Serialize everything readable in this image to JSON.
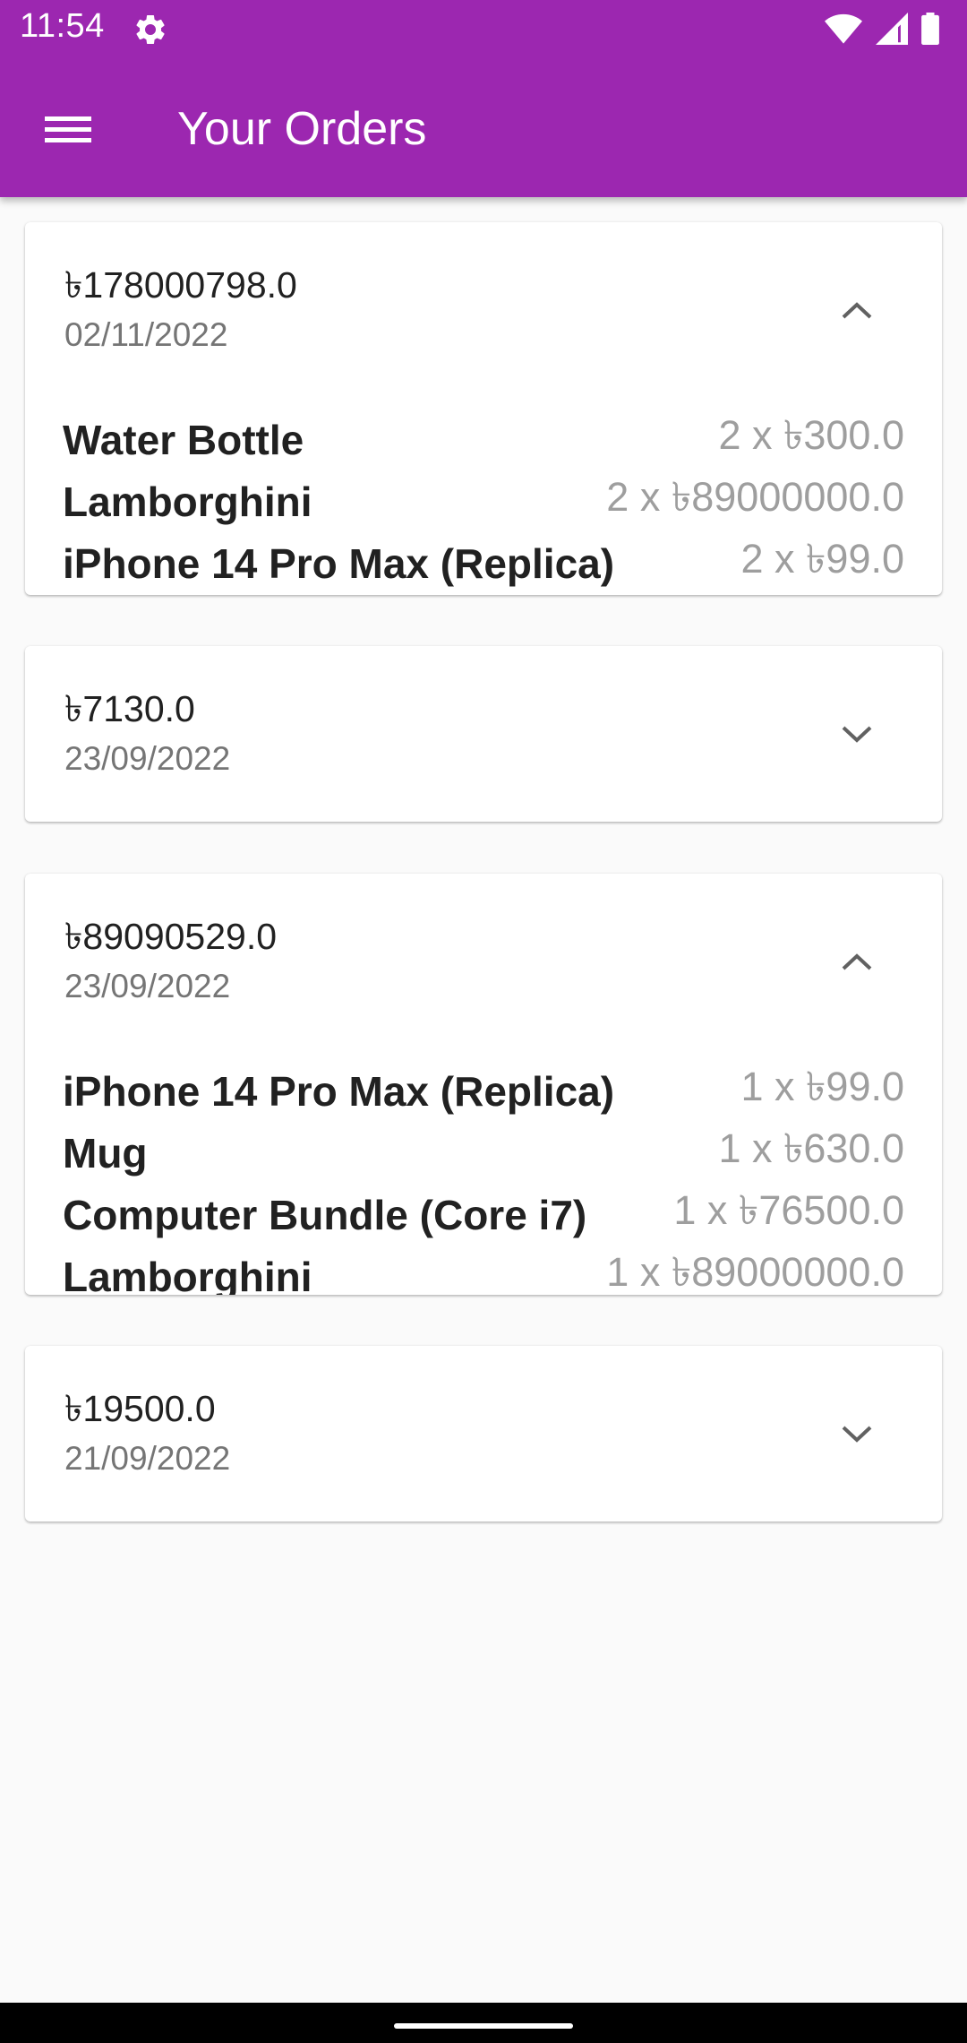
{
  "status_bar": {
    "time": "11:54",
    "icons": [
      "settings-icon",
      "wifi-icon",
      "signal-icon",
      "battery-icon"
    ]
  },
  "app_bar": {
    "title": "Your Orders",
    "menu_icon": "hamburger-menu-icon",
    "color": "#9c27b0"
  },
  "orders": [
    {
      "total": "৳178000798.0",
      "date": "02/11/2022",
      "expanded": true,
      "toggle_icon": "chevron-up-icon",
      "items": [
        {
          "name": "Water Bottle",
          "qty": "2 x ৳300.0"
        },
        {
          "name": "Lamborghini",
          "qty": "2 x ৳89000000.0"
        },
        {
          "name": "iPhone 14 Pro Max (Replica)",
          "qty": "2 x ৳99.0"
        }
      ]
    },
    {
      "total": "৳7130.0",
      "date": "23/09/2022",
      "expanded": false,
      "toggle_icon": "chevron-down-icon",
      "items": []
    },
    {
      "total": "৳89090529.0",
      "date": "23/09/2022",
      "expanded": true,
      "toggle_icon": "chevron-up-icon",
      "items": [
        {
          "name": "iPhone 14 Pro Max (Replica)",
          "qty": "1 x ৳99.0"
        },
        {
          "name": "Mug",
          "qty": "1 x ৳630.0"
        },
        {
          "name": "Computer Bundle (Core i7)",
          "qty": "1 x ৳76500.0"
        },
        {
          "name": "Lamborghini",
          "qty": "1 x ৳89000000.0"
        }
      ]
    },
    {
      "total": "৳19500.0",
      "date": "21/09/2022",
      "expanded": false,
      "toggle_icon": "chevron-down-icon",
      "items": []
    }
  ]
}
